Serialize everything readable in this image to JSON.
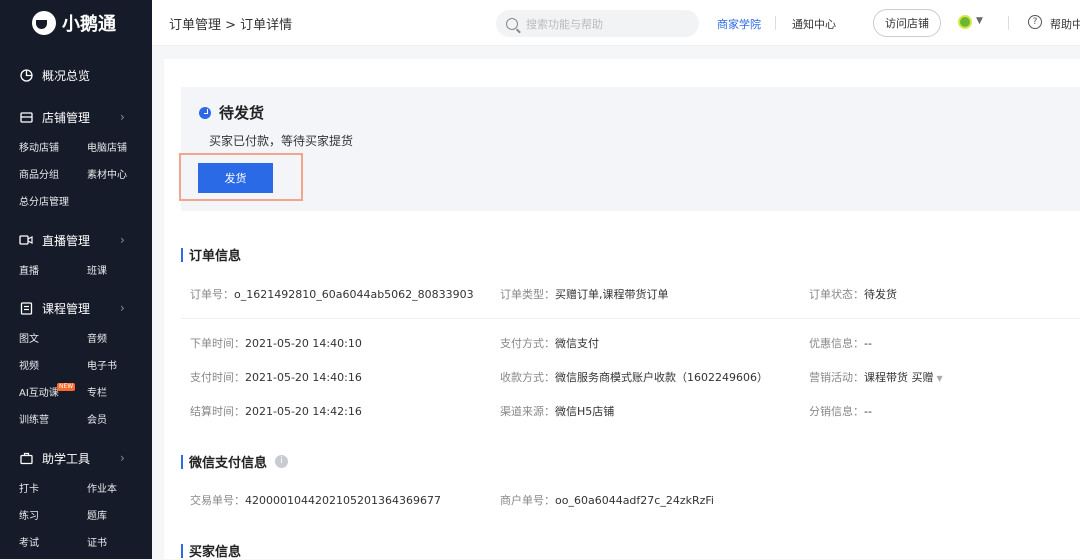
{
  "brand": {
    "name": "小鹅通"
  },
  "sidebar": {
    "overview": "概况总览",
    "groups": [
      {
        "label": "店铺管理",
        "items": [
          [
            "移动店铺",
            "电脑店铺"
          ],
          [
            "商品分组",
            "素材中心"
          ],
          [
            "总分店管理",
            ""
          ]
        ]
      },
      {
        "label": "直播管理",
        "items": [
          [
            "直播",
            "班课"
          ]
        ]
      },
      {
        "label": "课程管理",
        "items": [
          [
            "图文",
            "音频"
          ],
          [
            "视频",
            "电子书"
          ],
          [
            "AI互动课",
            "专栏"
          ],
          [
            "训练营",
            "会员"
          ]
        ],
        "new_tag": "NEW"
      },
      {
        "label": "助学工具",
        "items": [
          [
            "打卡",
            "作业本"
          ],
          [
            "练习",
            "题库"
          ],
          [
            "考试",
            "证书"
          ]
        ]
      }
    ]
  },
  "topbar": {
    "breadcrumb": "订单管理 > 订单详情",
    "search_placeholder": "搜索功能与帮助",
    "academy": "商家学院",
    "notify": "通知中心",
    "visit_store": "访问店铺",
    "help": "帮助中"
  },
  "status": {
    "title": "待发货",
    "desc": "买家已付款，等待买家提货",
    "ship_button": "发货"
  },
  "order_info": {
    "title": "订单信息",
    "order_no": {
      "k": "订单号：",
      "v": "o_1621492810_60a6044ab5062_80833903"
    },
    "order_type": {
      "k": "订单类型：",
      "v": "买赠订单,课程带货订单"
    },
    "order_status": {
      "k": "订单状态：",
      "v": "待发货"
    },
    "create_time": {
      "k": "下单时间：",
      "v": "2021-05-20 14:40:10"
    },
    "pay_method": {
      "k": "支付方式：",
      "v": "微信支付"
    },
    "discount": {
      "k": "优惠信息：",
      "v": "--"
    },
    "pay_time": {
      "k": "支付时间：",
      "v": "2021-05-20 14:40:16"
    },
    "collect_method": {
      "k": "收款方式：",
      "v": "微信服务商模式账户收款（1602249606）"
    },
    "marketing": {
      "k": "营销活动：",
      "v": "课程带货",
      "v2": "买赠"
    },
    "settle_time": {
      "k": "结算时间：",
      "v": "2021-05-20 14:42:16"
    },
    "channel": {
      "k": "渠道来源：",
      "v": "微信H5店铺"
    },
    "distribution": {
      "k": "分销信息：",
      "v": "--"
    }
  },
  "wechat_pay": {
    "title": "微信支付信息",
    "trade_no": {
      "k": "交易单号：",
      "v": "4200001044202105201364369677"
    },
    "merchant_no": {
      "k": "商户单号：",
      "v": "oo_60a6044adf27c_24zkRzFi"
    }
  },
  "buyer_info": {
    "title": "买家信息"
  }
}
